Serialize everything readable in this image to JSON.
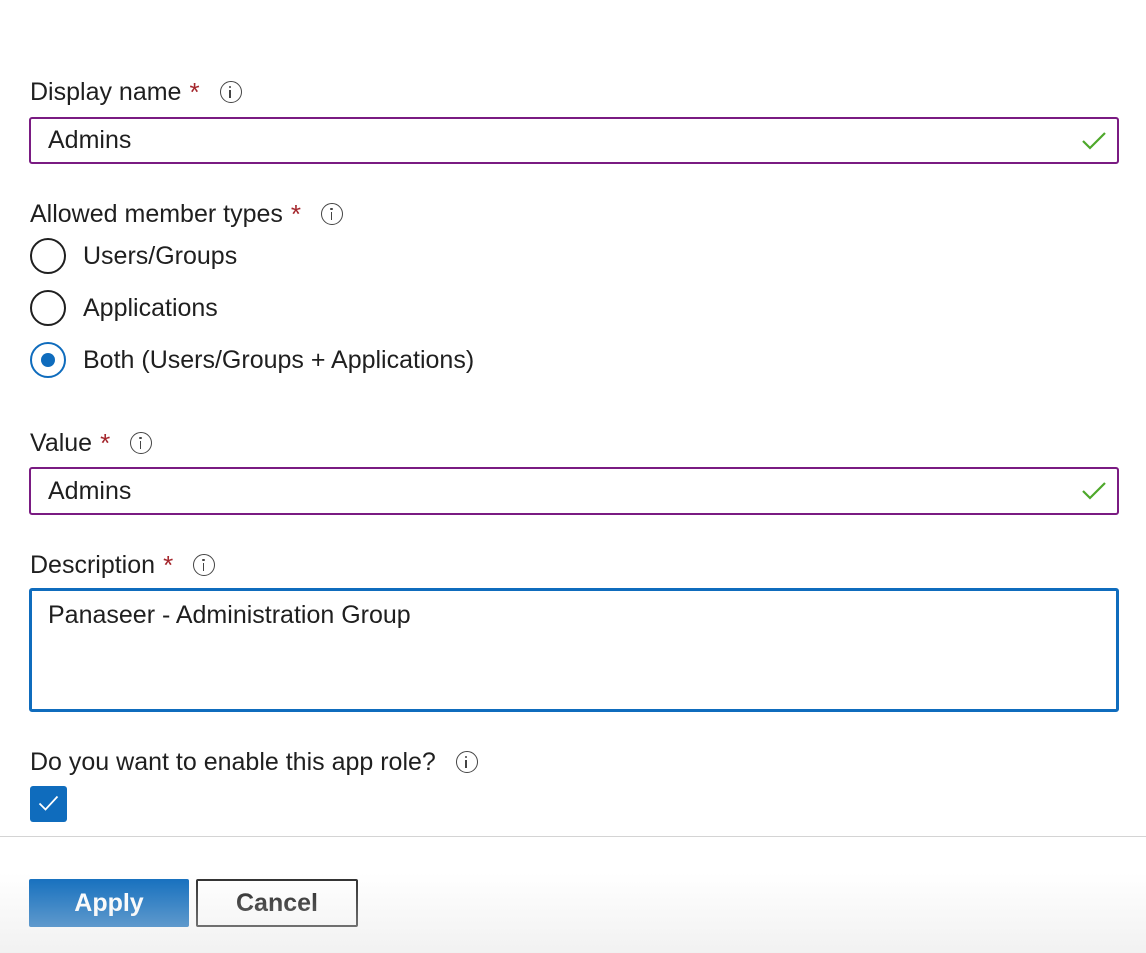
{
  "form": {
    "display_name": {
      "label": "Display name",
      "required_mark": "*",
      "value": "Admins",
      "status_icon": "checkmark-icon"
    },
    "member_types": {
      "label": "Allowed member types",
      "required_mark": "*",
      "options": [
        {
          "label": "Users/Groups",
          "selected": false
        },
        {
          "label": "Applications",
          "selected": false
        },
        {
          "label": "Both (Users/Groups + Applications)",
          "selected": true
        }
      ]
    },
    "value": {
      "label": "Value",
      "required_mark": "*",
      "value": "Admins",
      "status_icon": "checkmark-icon"
    },
    "description": {
      "label": "Description",
      "required_mark": "*",
      "value": "Panaseer - Administration Group"
    },
    "enable_role": {
      "label": "Do you want to enable this app role?",
      "checked": true
    }
  },
  "actions": {
    "apply_label": "Apply",
    "cancel_label": "Cancel"
  },
  "colors": {
    "accent": "#0f6cbd",
    "valid_border": "#7a1b82",
    "required": "#a4262c",
    "valid_check": "#4ea82b"
  }
}
